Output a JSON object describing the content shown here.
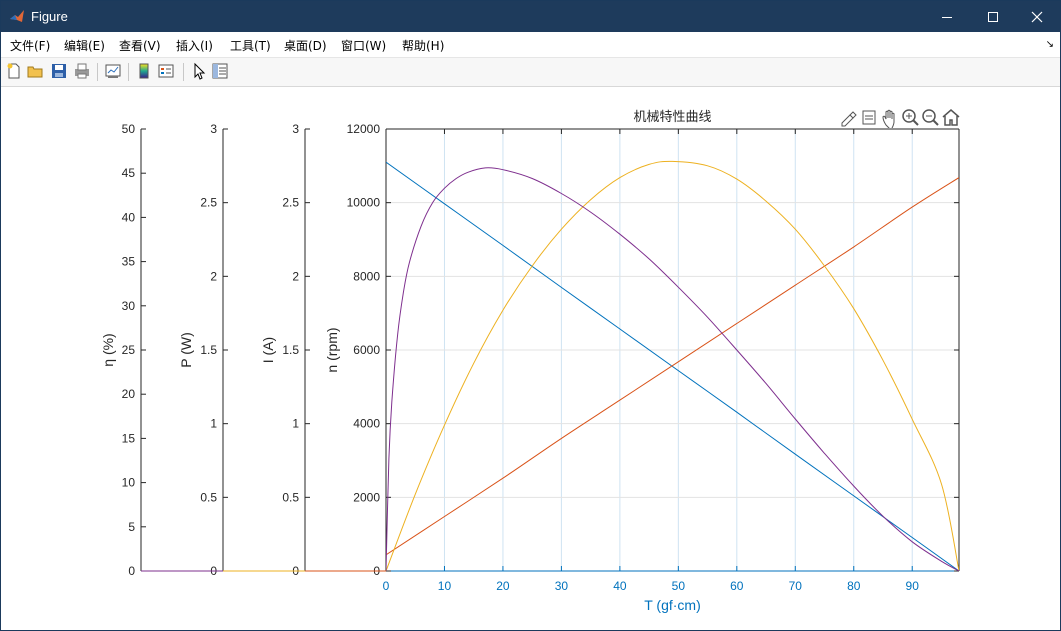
{
  "window": {
    "title": "Figure",
    "controls": {
      "minimize": "minimize",
      "maximize": "maximize",
      "close": "close"
    }
  },
  "menu": {
    "items": [
      {
        "label": "文件(F)"
      },
      {
        "label": "编辑(E)"
      },
      {
        "label": "查看(V)"
      },
      {
        "label": "插入(I)"
      },
      {
        "label": "工具(T)"
      },
      {
        "label": "桌面(D)"
      },
      {
        "label": "窗口(W)"
      },
      {
        "label": "帮助(H)"
      }
    ],
    "overflow_icon": "dock-arrow-icon"
  },
  "toolbar": {
    "buttons": [
      {
        "icon": "new-figure-icon"
      },
      {
        "icon": "open-file-icon"
      },
      {
        "icon": "save-icon"
      },
      {
        "icon": "print-icon"
      },
      {
        "icon": "link-plot-icon"
      },
      {
        "icon": "colorbar-icon"
      },
      {
        "icon": "legend-icon"
      },
      {
        "icon": "select-pointer-icon"
      },
      {
        "icon": "property-inspector-icon"
      }
    ]
  },
  "axes_toolbar": {
    "buttons": [
      {
        "icon": "brush-icon"
      },
      {
        "icon": "data-tips-icon"
      },
      {
        "icon": "pan-hand-icon"
      },
      {
        "icon": "zoom-in-icon"
      },
      {
        "icon": "zoom-out-icon"
      },
      {
        "icon": "home-icon"
      }
    ]
  },
  "chart_data": {
    "type": "line",
    "title": "机械特性曲线",
    "xlabel": "T (gf·cm)",
    "xlim": [
      0,
      98
    ],
    "xticks": [
      0,
      10,
      20,
      30,
      40,
      50,
      60,
      70,
      80,
      90
    ],
    "grid": true,
    "axes": [
      {
        "id": "eta",
        "label": "η (%)",
        "ylim": [
          0,
          50
        ],
        "ticks": [
          "0",
          "5",
          "10",
          "15",
          "20",
          "25",
          "30",
          "35",
          "40",
          "45",
          "50"
        ]
      },
      {
        "id": "p",
        "label": "P (W)",
        "ylim": [
          0,
          3
        ],
        "ticks": [
          "0",
          "0.5",
          "1",
          "1.5",
          "2",
          "2.5",
          "3"
        ]
      },
      {
        "id": "i",
        "label": "I (A)",
        "ylim": [
          0,
          3
        ],
        "ticks": [
          "0",
          "0.5",
          "1",
          "1.5",
          "2",
          "2.5",
          "3"
        ]
      },
      {
        "id": "n",
        "label": "n (rpm)",
        "ylim": [
          0,
          12000
        ],
        "ticks": [
          "0",
          "2000",
          "4000",
          "6000",
          "8000",
          "10000",
          "12000"
        ]
      }
    ],
    "series": [
      {
        "axis": "n",
        "color": "#0072bd",
        "x": [
          0,
          10,
          20,
          30,
          40,
          50,
          60,
          70,
          80,
          90,
          98
        ],
        "y": [
          11100,
          9970,
          8840,
          7700,
          6570,
          5440,
          4310,
          3170,
          2040,
          910,
          0
        ]
      },
      {
        "axis": "i",
        "color": "#d95319",
        "x": [
          0,
          10,
          20,
          30,
          40,
          50,
          60,
          70,
          80,
          90,
          98
        ],
        "y": [
          0.11,
          0.37,
          0.63,
          0.9,
          1.16,
          1.42,
          1.68,
          1.94,
          2.2,
          2.47,
          2.67
        ]
      },
      {
        "axis": "p",
        "color": "#edb120",
        "x": [
          0,
          5,
          10,
          15,
          20,
          25,
          30,
          35,
          40,
          45,
          49,
          55,
          60,
          65,
          70,
          75,
          80,
          85,
          90,
          95,
          98
        ],
        "y": [
          0,
          0.52,
          0.99,
          1.41,
          1.77,
          2.07,
          2.32,
          2.52,
          2.67,
          2.76,
          2.78,
          2.75,
          2.66,
          2.51,
          2.32,
          2.07,
          1.78,
          1.43,
          1.03,
          0.59,
          0
        ]
      },
      {
        "axis": "eta",
        "color": "#7e2f8e",
        "x": [
          0,
          0.5,
          1,
          2,
          3,
          4,
          6,
          8,
          10,
          12,
          14,
          17,
          20,
          25,
          30,
          35,
          40,
          45,
          50,
          55,
          60,
          65,
          70,
          75,
          80,
          85,
          90,
          95,
          98
        ],
        "y": [
          0,
          12.7,
          19.1,
          26.8,
          31.6,
          34.9,
          39.0,
          41.7,
          43.3,
          44.4,
          45.1,
          45.6,
          45.4,
          44.4,
          42.7,
          40.6,
          38.1,
          35.3,
          32.1,
          28.7,
          25.0,
          21.2,
          17.2,
          13.3,
          9.6,
          6.2,
          3.3,
          1.1,
          0
        ]
      }
    ]
  }
}
